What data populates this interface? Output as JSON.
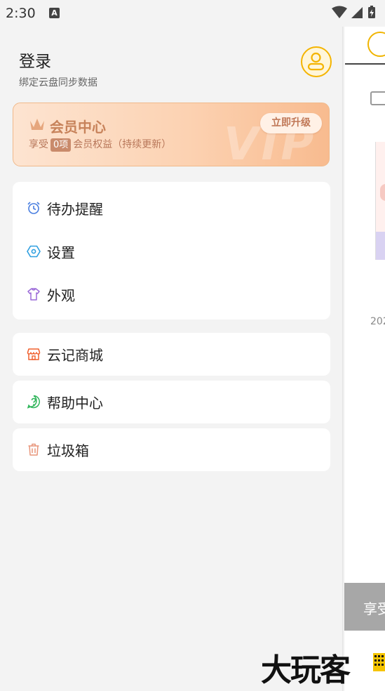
{
  "status_bar": {
    "time": "2:30",
    "notification_icon_letter": "A"
  },
  "drawer": {
    "login_title": "登录",
    "login_subtitle": "绑定云盘同步数据",
    "vip": {
      "title": "会员中心",
      "prefix": "享受",
      "count": "0项",
      "suffix": "会员权益（持续更新）",
      "upgrade_button": "立即升级",
      "watermark": "VIP"
    },
    "group1": [
      {
        "label": "待办提醒",
        "icon": "alarm-clock-icon",
        "color": "#4a7fe0"
      },
      {
        "label": "设置",
        "icon": "settings-hexagon-icon",
        "color": "#2f9fe0"
      },
      {
        "label": "外观",
        "icon": "tshirt-icon",
        "color": "#9b6ad8"
      }
    ],
    "group2": [
      {
        "label": "云记商城",
        "icon": "store-icon",
        "color": "#f0602e"
      }
    ],
    "group3": [
      {
        "label": "帮助中心",
        "icon": "help-circle-icon",
        "color": "#2fb55a"
      }
    ],
    "group4": [
      {
        "label": "垃圾箱",
        "icon": "trash-icon",
        "color": "#e8957a"
      }
    ]
  },
  "background_app": {
    "year_partial": "202",
    "banner_partial": "享受"
  },
  "watermark_logo": "大玩客",
  "colors": {
    "accent_gold": "#f4b400",
    "vip_text": "#c7825a",
    "page_bg": "#f3f3f3"
  }
}
